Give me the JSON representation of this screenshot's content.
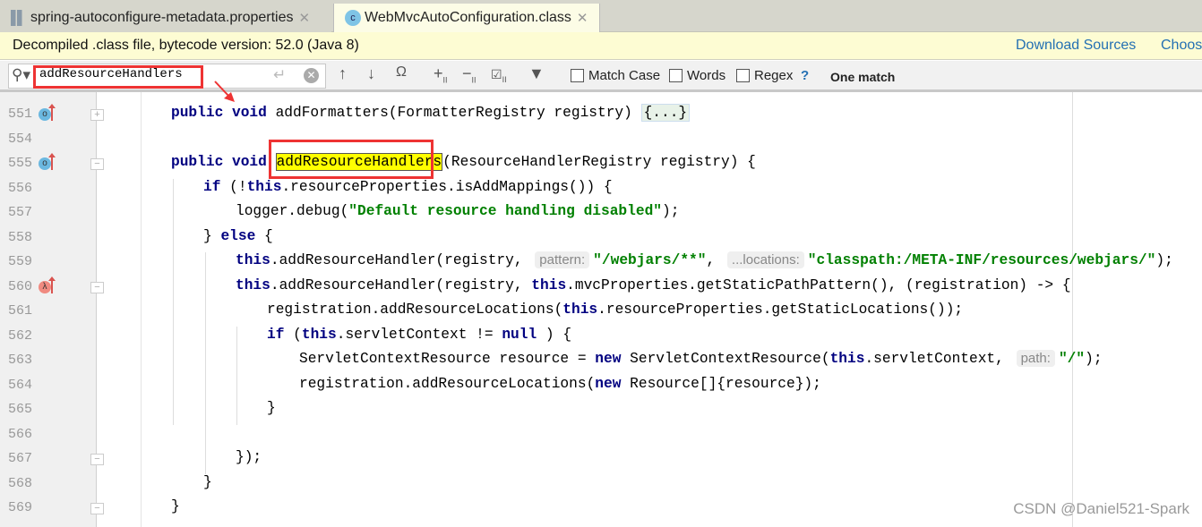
{
  "tabs": [
    {
      "label": "spring-autoconfigure-metadata.properties",
      "icon": "properties-file-icon",
      "active": false
    },
    {
      "label": "WebMvcAutoConfiguration.class",
      "icon": "class-file-icon",
      "active": true
    }
  ],
  "banner": {
    "text": "Decompiled .class file, bytecode version: 52.0 (Java 8)",
    "download_sources": "Download Sources",
    "choose_sources": "Choos"
  },
  "search": {
    "value": "addResourceHandlers",
    "match_case": "Match Case",
    "words": "Words",
    "regex": "Regex",
    "help": "?",
    "status": "One match"
  },
  "colors": {
    "keyword": "#000080",
    "string": "#008000",
    "highlight": "#ffff00",
    "annotation": "#ee3333",
    "link": "#2470b3"
  },
  "lines": [
    {
      "num": "551",
      "icon": "override-icon",
      "fold": "+",
      "segs": [
        [
          "kw",
          "public void "
        ],
        [
          "",
          "addFormatters(FormatterRegistry registry) "
        ],
        [
          "fold",
          "{...}"
        ]
      ],
      "indent": 1
    },
    {
      "num": "554",
      "segs": [],
      "indent": 1
    },
    {
      "num": "555",
      "icon": "override-icon",
      "fold": "-",
      "segs": [
        [
          "kw",
          "public void "
        ],
        [
          "hl",
          "addResourceHandlers"
        ],
        [
          "",
          "(ResourceHandlerRegistry registry) {"
        ]
      ],
      "indent": 1
    },
    {
      "num": "556",
      "segs": [
        [
          "kw",
          "if "
        ],
        [
          "",
          "(!"
        ],
        [
          "kw",
          "this"
        ],
        [
          "",
          ".resourceProperties.isAddMappings()) {"
        ]
      ],
      "indent": 2
    },
    {
      "num": "557",
      "segs": [
        [
          "",
          "logger.debug("
        ],
        [
          "str",
          "\"Default resource handling disabled\""
        ],
        [
          "",
          ");"
        ]
      ],
      "indent": 3
    },
    {
      "num": "558",
      "segs": [
        [
          "",
          "} "
        ],
        [
          "kw",
          "else "
        ],
        [
          "",
          "{"
        ]
      ],
      "indent": 2
    },
    {
      "num": "559",
      "segs": [
        [
          "kw",
          "this"
        ],
        [
          "",
          ".addResourceHandler(registry, "
        ],
        [
          "hint",
          "pattern:"
        ],
        [
          "str",
          "\"/webjars/**\""
        ],
        [
          "",
          ", "
        ],
        [
          "hint",
          "...locations:"
        ],
        [
          "str",
          "\"classpath:/META-INF/resources/webjars/\""
        ],
        [
          "",
          ");"
        ]
      ],
      "indent": 3
    },
    {
      "num": "560",
      "icon": "lambda-icon",
      "fold": "-",
      "segs": [
        [
          "kw",
          "this"
        ],
        [
          "",
          ".addResourceHandler(registry, "
        ],
        [
          "kw",
          "this"
        ],
        [
          "",
          ".mvcProperties.getStaticPathPattern(), (registration) -> {"
        ]
      ],
      "indent": 3
    },
    {
      "num": "561",
      "segs": [
        [
          "",
          "registration.addResourceLocations("
        ],
        [
          "kw",
          "this"
        ],
        [
          "",
          ".resourceProperties.getStaticLocations());"
        ]
      ],
      "indent": 4
    },
    {
      "num": "562",
      "segs": [
        [
          "kw",
          "if "
        ],
        [
          "",
          "("
        ],
        [
          "kw",
          "this"
        ],
        [
          "",
          ".servletContext != "
        ],
        [
          "kw",
          "null"
        ],
        [
          "",
          " ) {"
        ]
      ],
      "indent": 4
    },
    {
      "num": "563",
      "segs": [
        [
          "",
          "ServletContextResource resource = "
        ],
        [
          "kw",
          "new "
        ],
        [
          "",
          "ServletContextResource("
        ],
        [
          "kw",
          "this"
        ],
        [
          "",
          ".servletContext, "
        ],
        [
          "hint",
          "path:"
        ],
        [
          "str",
          "\"/\""
        ],
        [
          "",
          ");"
        ]
      ],
      "indent": 5
    },
    {
      "num": "564",
      "segs": [
        [
          "",
          "registration.addResourceLocations("
        ],
        [
          "kw",
          "new "
        ],
        [
          "",
          "Resource[]{resource});"
        ]
      ],
      "indent": 5
    },
    {
      "num": "565",
      "segs": [
        [
          "",
          "}"
        ]
      ],
      "indent": 4
    },
    {
      "num": "566",
      "segs": [],
      "indent": 4
    },
    {
      "num": "567",
      "fold": "-",
      "segs": [
        [
          "",
          "});"
        ]
      ],
      "indent": 3
    },
    {
      "num": "568",
      "segs": [
        [
          "",
          "}"
        ]
      ],
      "indent": 2
    },
    {
      "num": "569",
      "fold": "-",
      "segs": [
        [
          "",
          "}"
        ]
      ],
      "indent": 1
    }
  ],
  "watermark": "CSDN @Daniel521-Spark"
}
